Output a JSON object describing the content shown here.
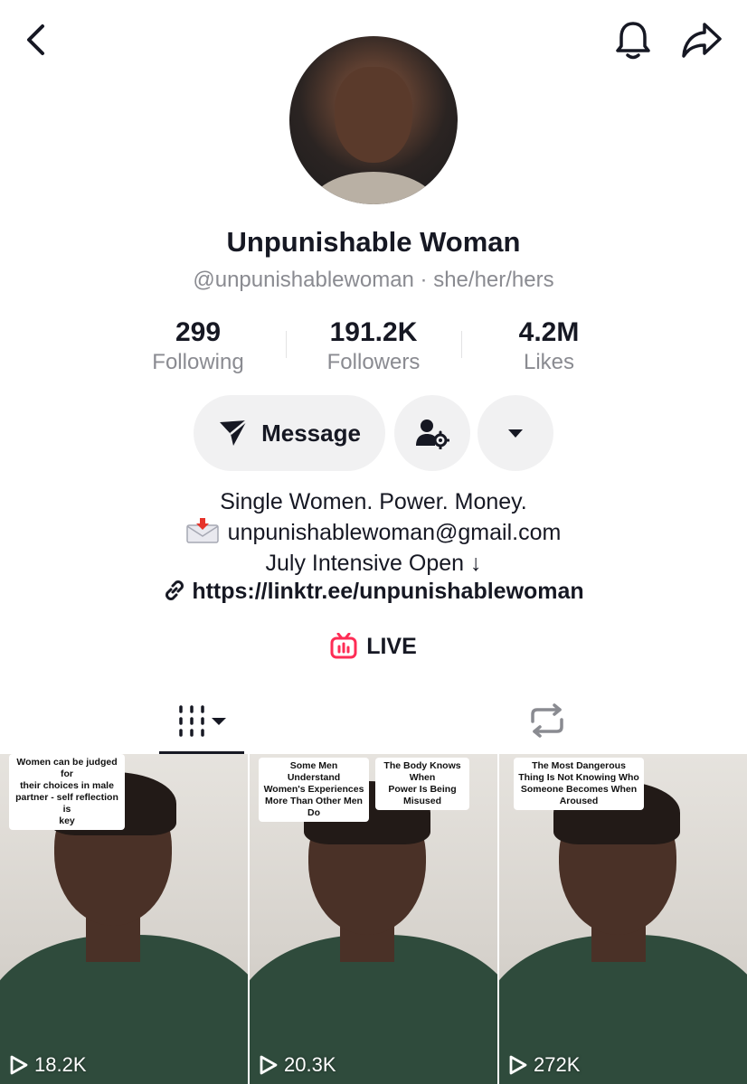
{
  "profile": {
    "display_name": "Unpunishable Woman",
    "handle_line": "@unpunishablewoman · she/her/hers"
  },
  "stats": [
    {
      "value": "299",
      "label": "Following"
    },
    {
      "value": "191.2K",
      "label": "Followers"
    },
    {
      "value": "4.2M",
      "label": "Likes"
    }
  ],
  "actions": {
    "message_label": "Message"
  },
  "bio": {
    "line1": "Single Women. Power. Money.",
    "email": "unpunishablewoman@gmail.com",
    "line3": "July Intensive Open ↓",
    "link": "https://linktr.ee/unpunishablewoman"
  },
  "live": {
    "label": "LIVE",
    "color": "#fe2c55"
  },
  "videos": [
    {
      "captions": [
        "Women can be judged for\ntheir choices in male\npartner - self reflection is\nkey"
      ],
      "views": "18.2K"
    },
    {
      "captions": [
        "Some Men Understand\nWomen's Experiences\nMore Than Other Men Do",
        "The Body Knows When\nPower Is Being Misused"
      ],
      "views": "20.3K"
    },
    {
      "captions": [
        "The Most Dangerous\nThing Is Not Knowing Who\nSomeone Becomes When\nAroused"
      ],
      "views": "272K"
    }
  ],
  "icons": {
    "back": "chevron-left-icon",
    "bell": "bell-icon",
    "share": "share-arrow-icon",
    "message": "send-icon",
    "add_friend": "person-settings-icon",
    "more": "caret-down-icon",
    "link": "link-icon",
    "live": "live-tv-icon",
    "videos_tab": "grid-bars-icon",
    "reposts_tab": "repost-icon",
    "play": "play-outline-icon"
  }
}
